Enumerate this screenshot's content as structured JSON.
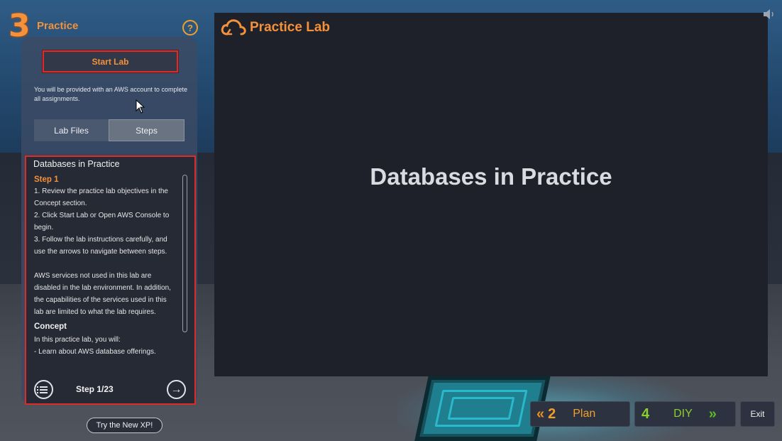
{
  "header": {
    "step_number": "3",
    "step_title": "Practice",
    "help_label": "?"
  },
  "left_panel": {
    "start_lab_label": "Start Lab",
    "note": "You will be provided with an AWS account to complete all assignments.",
    "tabs": [
      {
        "label": "Lab Files",
        "active": false
      },
      {
        "label": "Steps",
        "active": true
      }
    ],
    "content": {
      "title": "Databases in Practice",
      "step_heading": "Step 1",
      "instructions": [
        "1. Review the practice lab objectives in the Concept section.",
        "2. Click Start Lab or Open AWS Console to begin.",
        "3. Follow the lab instructions carefully, and use the arrows to navigate between steps."
      ],
      "notice": "AWS services not used in this lab are disabled in the lab environment. In addition, the capabilities of the services used in this lab are limited to what the lab requires.",
      "concept_heading": "Concept",
      "concept_intro": "In this practice lab, you will:",
      "concept_items": [
        "- Learn about AWS database offerings."
      ]
    },
    "step_counter": "Step 1/23"
  },
  "try_xp_label": "Try the New XP!",
  "stage": {
    "logo_text": "Practice Lab",
    "title": "Databases in Practice"
  },
  "bottom_nav": {
    "prev_chevrons": "«",
    "prev_number": "2",
    "prev_label": "Plan",
    "next_number": "4",
    "next_label": "DIY",
    "next_chevrons": "»",
    "exit_label": "Exit"
  },
  "colors": {
    "accent_orange": "#f5913a",
    "accent_green": "#88d02c",
    "highlight_red": "#e02a2a"
  },
  "icons": {
    "help": "question-circle-icon",
    "list": "list-icon",
    "next": "arrow-right-circle-icon",
    "logo": "cloud-icon",
    "speaker": "speaker-icon",
    "cursor": "mouse-cursor-icon"
  }
}
